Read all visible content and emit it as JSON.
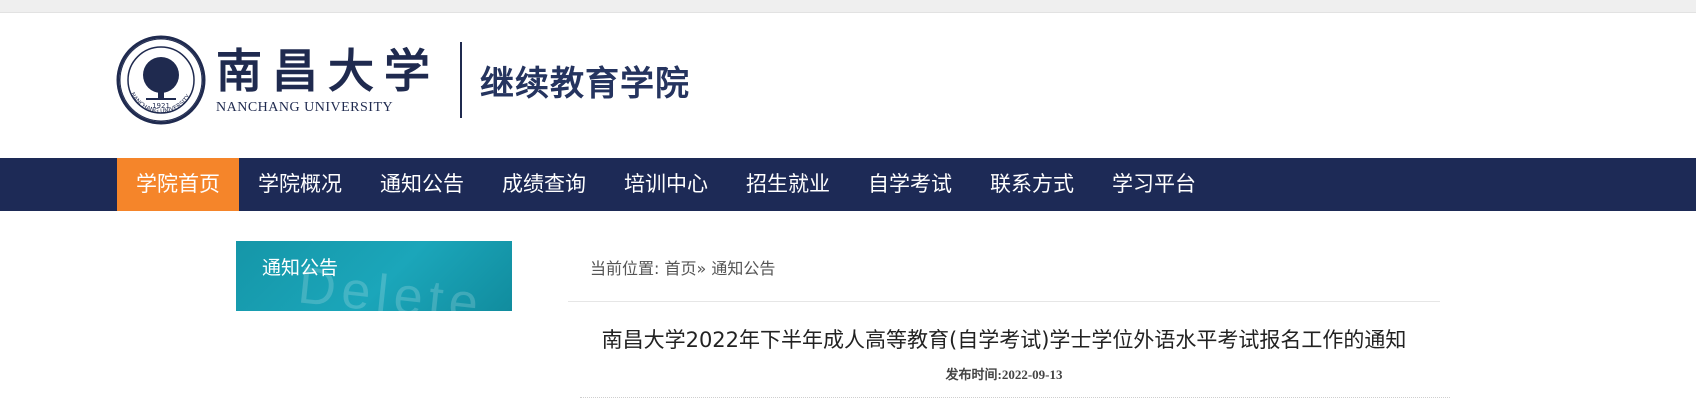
{
  "header": {
    "university_cn": "南昌大学",
    "university_en": "NANCHANG UNIVERSITY",
    "college_name": "继续教育学院",
    "seal_year": "1921",
    "seal_text": "NANCHANG UNIVERSITY"
  },
  "nav": {
    "items": [
      {
        "label": "学院首页",
        "active": true
      },
      {
        "label": "学院概况"
      },
      {
        "label": "通知公告"
      },
      {
        "label": "成绩查询"
      },
      {
        "label": "培训中心"
      },
      {
        "label": "招生就业"
      },
      {
        "label": "自学考试"
      },
      {
        "label": "联系方式"
      },
      {
        "label": "学习平台"
      }
    ]
  },
  "sidebar": {
    "title": "通知公告",
    "watermark": "Delete"
  },
  "breadcrumb": {
    "prefix": "当前位置:",
    "home": "首页",
    "sep": "»",
    "current": "通知公告"
  },
  "article": {
    "title": "南昌大学2022年下半年成人高等教育(自学考试)学士学位外语水平考试报名工作的通知",
    "publish_label": "发布时间:",
    "publish_date": "2022-09-13"
  },
  "colors": {
    "nav_bg": "#1d2a56",
    "nav_active": "#f5852a",
    "sidebar_title_bg": "#1ba6ba",
    "brand_navy": "#1f2a4f"
  }
}
